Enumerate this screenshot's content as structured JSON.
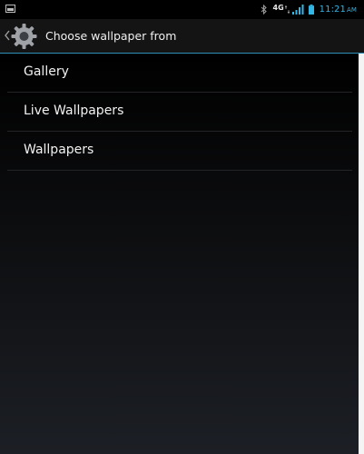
{
  "status_bar": {
    "network": "4G",
    "time": "11:21",
    "ampm": "AM"
  },
  "action_bar": {
    "title": "Choose wallpaper from",
    "icon": "settings-gear-icon"
  },
  "list": {
    "items": [
      {
        "label": "Gallery"
      },
      {
        "label": "Live Wallpapers"
      },
      {
        "label": "Wallpapers"
      }
    ]
  },
  "colors": {
    "accent": "#33b5e5",
    "divider": "#2f8fb4",
    "text": "#f2f2f2",
    "background": "#000000"
  }
}
